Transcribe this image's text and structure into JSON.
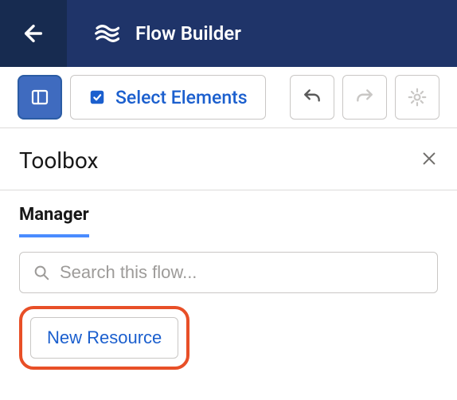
{
  "header": {
    "title": "Flow Builder"
  },
  "toolbar": {
    "select_label": "Select Elements"
  },
  "panel": {
    "title": "Toolbox"
  },
  "tabs": {
    "manager": "Manager"
  },
  "search": {
    "placeholder": "Search this flow..."
  },
  "buttons": {
    "new_resource": "New Resource"
  }
}
